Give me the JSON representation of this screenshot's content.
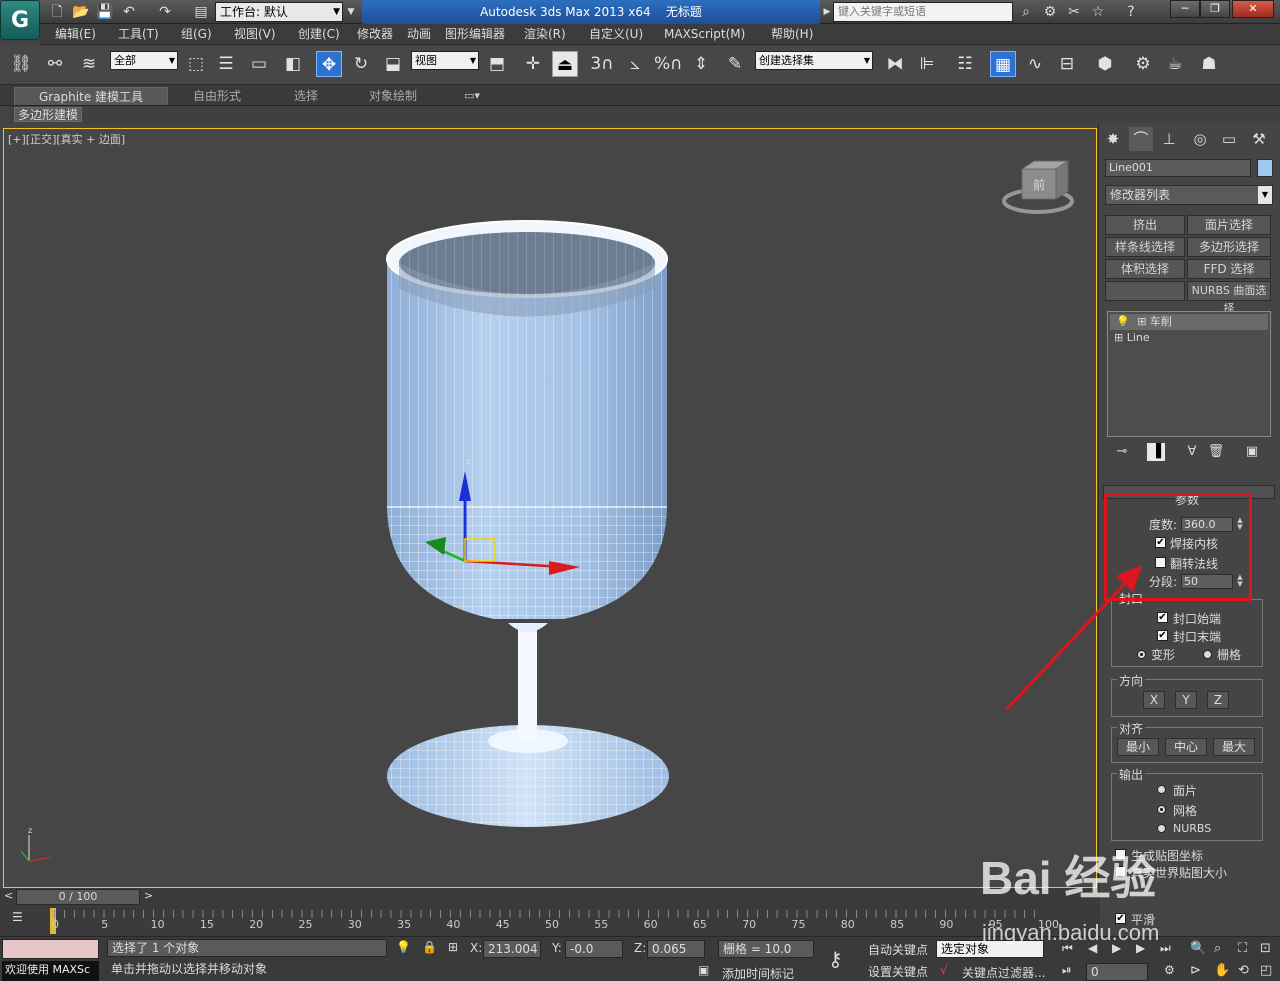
{
  "title": {
    "workspace_label": "工作台: 默认",
    "app_title": "Autodesk 3ds Max  2013 x64",
    "file_title": "无标题",
    "search_placeholder": "键入关键字或短语"
  },
  "menu": [
    "编辑(E)",
    "工具(T)",
    "组(G)",
    "视图(V)",
    "创建(C)",
    "修改器",
    "动画",
    "图形编辑器",
    "渲染(R)",
    "自定义(U)",
    "MAXScript(M)",
    "帮助(H)"
  ],
  "toolbar": {
    "selection_filter": "全部",
    "ref_coord": "视图",
    "named_selection": "创建选择集",
    "snap_angle_label": "3",
    "percent_label": "%"
  },
  "ribbon": {
    "tabs": [
      "Graphite 建模工具",
      "自由形式",
      "选择",
      "对象绘制"
    ],
    "sub_label": "多边形建模"
  },
  "viewport": {
    "label": "[+][正交][真实 + 边面]",
    "viewcube_face": "前"
  },
  "command_panel": {
    "object_name": "Line001",
    "modifier_list": "修改器列表",
    "mod_buttons": [
      "挤出",
      "面片选择",
      "样条线选择",
      "多边形选择",
      "体积选择",
      "FFD 选择",
      "",
      "NURBS 曲面选择"
    ],
    "stack": [
      "车削",
      "Line"
    ],
    "params_title": "参数",
    "degrees_label": "度数:",
    "degrees_value": "360.0",
    "weld_core": "焊接内核",
    "flip_normals": "翻转法线",
    "segments_label": "分段:",
    "segments_value": "50",
    "capping_title": "封口",
    "cap_start": "封口始端",
    "cap_end": "封口末端",
    "morph": "变形",
    "grid": "栅格",
    "direction_title": "方向",
    "dir_x": "X",
    "dir_y": "Y",
    "dir_z": "Z",
    "align_title": "对齐",
    "align_min": "最小",
    "align_center": "中心",
    "align_max": "最大",
    "output_title": "输出",
    "out_patch": "面片",
    "out_mesh": "网格",
    "out_nurbs": "NURBS",
    "gen_map_coords": "生成贴图坐标",
    "real_world_map": "真实世界贴图大小",
    "smooth": "平滑",
    "checks": {
      "weld_core": true,
      "flip_normals": false,
      "cap_start": true,
      "cap_end": true
    },
    "output_selected": "mesh",
    "capping_selected": "morph"
  },
  "timeline": {
    "slider_label": "0 / 100",
    "ticks": [
      "0",
      "5",
      "10",
      "15",
      "20",
      "25",
      "30",
      "35",
      "40",
      "45",
      "50",
      "55",
      "60",
      "65",
      "70",
      "75",
      "80",
      "85",
      "90",
      "95",
      "100"
    ]
  },
  "status": {
    "selection_text": "选择了 1 个对象",
    "prompt_text": "单击并拖动以选择并移动对象",
    "x_label": "X:",
    "x_value": "213.004",
    "y_label": "Y:",
    "y_value": "-0.0",
    "z_label": "Z:",
    "z_value": "0.065",
    "grid_text": "栅格 = 10.0",
    "add_time_tag": "添加时间标记",
    "auto_key": "自动关键点",
    "set_key": "设置关键点",
    "key_target": "选定对象",
    "key_filters": "关键点过滤器...",
    "frame_value": "0",
    "welcome": "欢迎使用 MAXSc"
  },
  "watermark": {
    "brand": "Bai 经验",
    "url": "jingyan.baidu.com"
  },
  "colors": {
    "viewport_border": "#f2c12e",
    "highlight": "#e0141d",
    "title_accent": "#2b6fbf",
    "glass_fill": "#a9c8ec"
  }
}
